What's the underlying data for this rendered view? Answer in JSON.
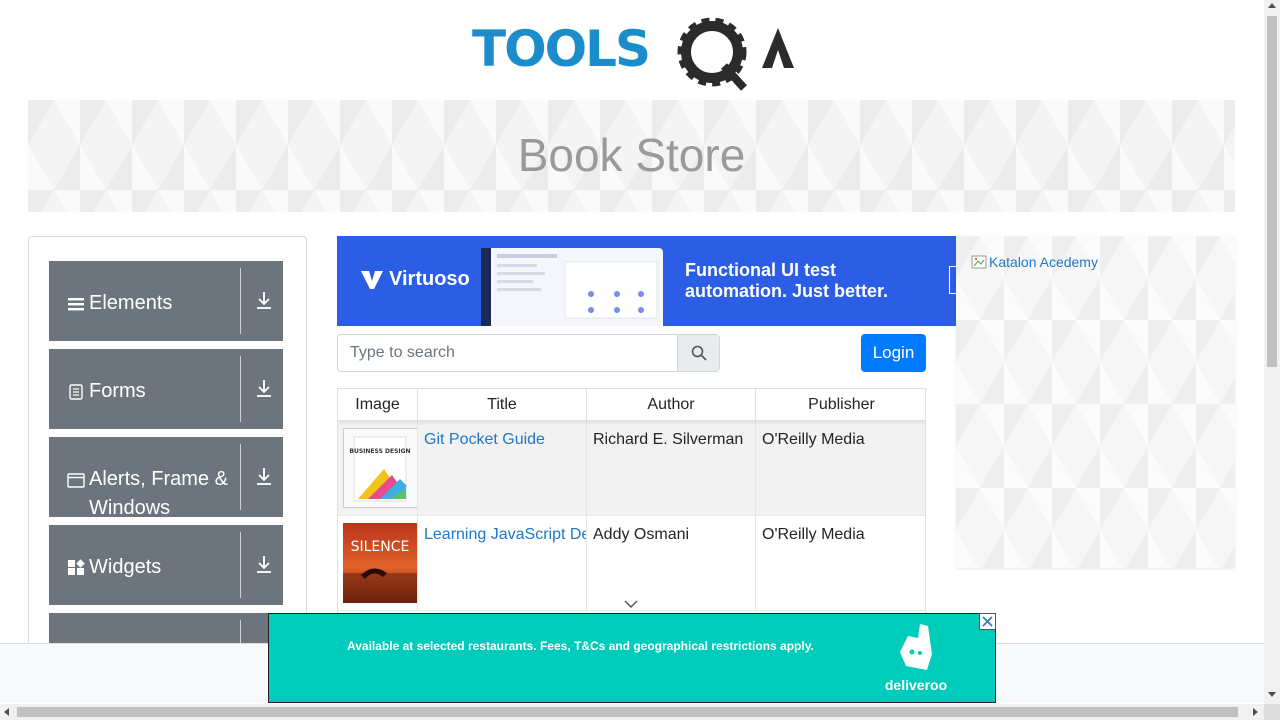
{
  "header": {
    "logo_text": "TOOLSQA",
    "banner_title": "Book Store"
  },
  "sidebar": {
    "groups": [
      {
        "label": "Elements",
        "icon": "hamburger-icon"
      },
      {
        "label": "Forms",
        "icon": "document-icon"
      },
      {
        "label": "Alerts, Frame & Windows",
        "icon": "window-icon"
      },
      {
        "label": "Widgets",
        "icon": "widgets-grid-icon"
      }
    ]
  },
  "ad_top": {
    "brand": "Virtuoso",
    "tagline": "Functional UI test automation. Just better."
  },
  "search": {
    "placeholder": "Type to search"
  },
  "login": {
    "label": "Login"
  },
  "table": {
    "headers": [
      "Image",
      "Title",
      "Author",
      "Publisher"
    ],
    "rows": [
      {
        "title": "Git Pocket Guide",
        "author": "Richard E. Silverman",
        "publisher": "O'Reilly Media",
        "cover_text": "BUSINESS DESIGN"
      },
      {
        "title": "Learning JavaScript Design Patterns",
        "author": "Addy Osmani",
        "publisher": "O'Reilly Media",
        "cover_text": "SILENCE"
      }
    ]
  },
  "ad_right": {
    "image_alt": "Katalon Acedemy"
  },
  "ad_bottom": {
    "disclaimer": "Available at selected restaurants. Fees, T&Cs and geographical restrictions apply.",
    "brand": "deliveroo",
    "accent": "#00ccbc"
  },
  "colors": {
    "primary": "#007bff",
    "sidebar": "#6c757d",
    "link": "#1e78c8"
  }
}
